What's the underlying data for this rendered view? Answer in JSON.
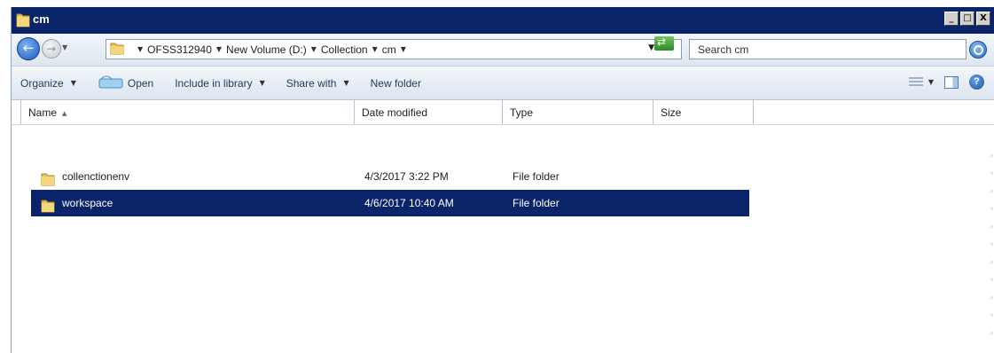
{
  "window": {
    "title": "cm"
  },
  "titlebar_buttons": {
    "minimize": "_",
    "maximize": "□",
    "close": "X"
  },
  "address": {
    "crumbs": [
      "OFSS312940",
      "New Volume (D:)",
      "Collection",
      "cm"
    ]
  },
  "search": {
    "placeholder": "Search cm"
  },
  "toolbar": {
    "organize": "Organize",
    "open": "Open",
    "include_in_library": "Include in library",
    "share_with": "Share with",
    "new_folder": "New folder"
  },
  "columns": {
    "name": "Name",
    "date_modified": "Date modified",
    "type": "Type",
    "size": "Size"
  },
  "files": [
    {
      "name": "collenctionenv",
      "date_modified": "4/3/2017 3:22 PM",
      "type": "File folder",
      "selected": false
    },
    {
      "name": "workspace",
      "date_modified": "4/6/2017 10:40 AM",
      "type": "File folder",
      "selected": true
    }
  ],
  "colors": {
    "titlebar": "#0a246a",
    "selection": "#0a246a",
    "folder": "#e8c35a"
  },
  "icons": {
    "back": "back-arrow-icon",
    "forward": "forward-arrow-icon",
    "refresh": "refresh-icon",
    "search": "search-icon",
    "help": "help-icon"
  }
}
